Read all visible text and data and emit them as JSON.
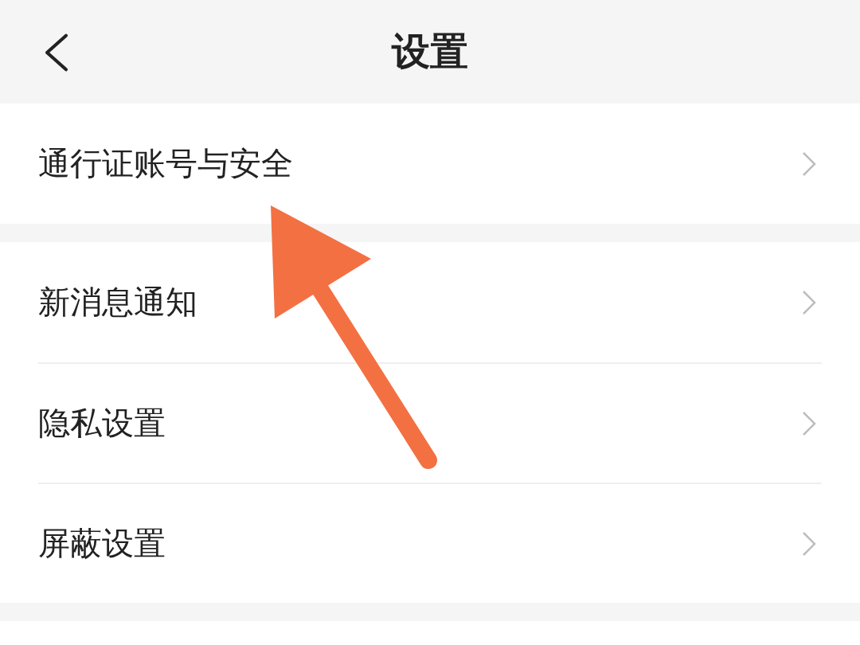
{
  "header": {
    "title": "设置"
  },
  "groups": [
    {
      "items": [
        {
          "label": "通行证账号与安全"
        }
      ]
    },
    {
      "items": [
        {
          "label": "新消息通知"
        },
        {
          "label": "隐私设置"
        },
        {
          "label": "屏蔽设置"
        }
      ]
    }
  ]
}
